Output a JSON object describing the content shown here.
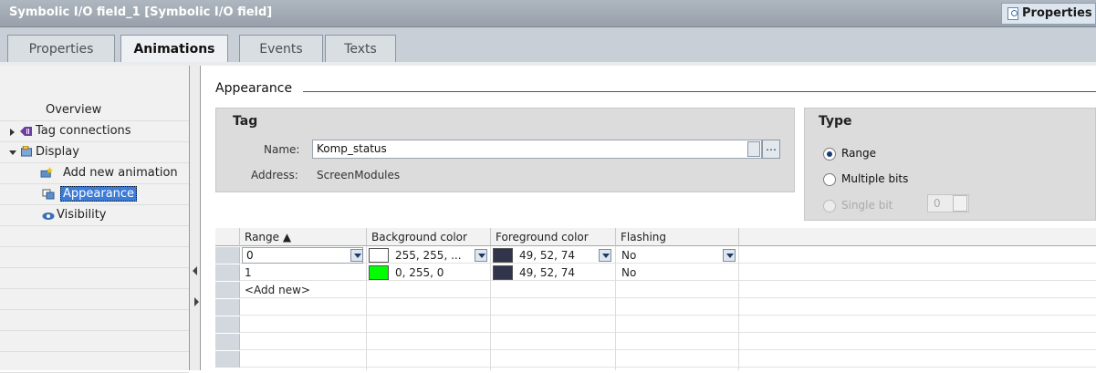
{
  "window": {
    "title": "Symbolic I/O field_1 [Symbolic I/O field]",
    "properties_button": "Properties"
  },
  "tabs": [
    "Properties",
    "Animations",
    "Events",
    "Texts"
  ],
  "active_tab": "Animations",
  "nav": {
    "overview": "Overview",
    "tag_connections": "Tag connections",
    "display": "Display",
    "add_new_animation": "Add new animation",
    "appearance": "Appearance",
    "visibility": "Visibility"
  },
  "section_title": "Appearance",
  "tag": {
    "title": "Tag",
    "name_label": "Name:",
    "name_value": "Komp_status",
    "address_label": "Address:",
    "address_value": "ScreenModules"
  },
  "type": {
    "title": "Type",
    "options": [
      "Range",
      "Multiple bits",
      "Single bit"
    ],
    "selected": "Range",
    "bit_value": "0"
  },
  "table": {
    "headers": [
      "Range ▲",
      "Background color",
      "Foreground color",
      "Flashing"
    ],
    "rows": [
      {
        "range": "0",
        "bg": "255, 255, ...",
        "bg_color": "#ffffff",
        "fg": "49, 52, 74",
        "fg_color": "#31344a",
        "flashing": "No"
      },
      {
        "range": "1",
        "bg": "0, 255, 0",
        "bg_color": "#00ff00",
        "fg": "49, 52, 74",
        "fg_color": "#31344a",
        "flashing": "No"
      }
    ],
    "add_new": "<Add new>"
  }
}
